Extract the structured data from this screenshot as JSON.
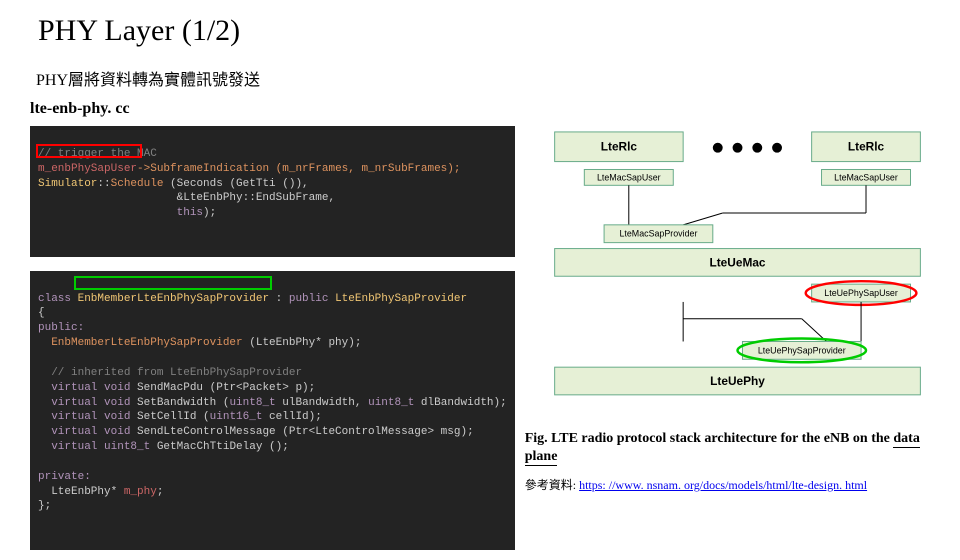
{
  "title": "PHY Layer (1/2)",
  "subtitle": "PHY層將資料轉為實體訊號發送",
  "filename": "lte-enb-phy. cc",
  "code1": {
    "c0": "// trigger the MAC",
    "l1a": "m_enbPhySapUser",
    "l1b": "->SubframeIndication (m_nrFrames, m_nrSubFrames);",
    "l2a": "Simulator",
    "l2b": "::",
    "l2c": "Schedule",
    "l2d": " (Seconds (GetTti ()),",
    "l3": "                     &LteEnbPhy::EndSubFrame,",
    "l4a": "                     ",
    "l4b": "this",
    "l4c": ");"
  },
  "code2": {
    "l1a": "class ",
    "l1b": "EnbMemberLteEnbPhySapProvider",
    "l1c": " : ",
    "l1d": "public",
    "l1e": " LteEnbPhySapProvider",
    "l2": "{",
    "l3": "public:",
    "l4a": "  ",
    "l4b": "EnbMemberLteEnbPhySapProvider",
    "l4c": " (LteEnbPhy* phy);",
    "blank": "",
    "c2": "  // inherited from LteEnbPhySapProvider",
    "l5a": "  virtual ",
    "l5b": "void",
    "l5c": " SendMacPdu (Ptr<Packet> p);",
    "l6a": "  virtual ",
    "l6b": "void",
    "l6c": " SetBandwidth (",
    "l6d": "uint8_t",
    "l6e": " ulBandwidth, ",
    "l6f": "uint8_t",
    "l6g": " dlBandwidth);",
    "l7a": "  virtual ",
    "l7b": "void",
    "l7c": " SetCellId (",
    "l7d": "uint16_t",
    "l7e": " cellId);",
    "l8a": "  virtual ",
    "l8b": "void",
    "l8c": " SendLteControlMessage (Ptr<LteControlMessage> msg);",
    "l9a": "  virtual ",
    "l9b": "uint8_t",
    "l9c": " GetMacChTtiDelay ();",
    "l10": "",
    "l11": "private:",
    "l12a": "  LteEnbPhy* ",
    "l12b": "m_phy",
    "l12c": ";",
    "l13": "};"
  },
  "diagram": {
    "rlc_l": "LteRlc",
    "rlc_r": "LteRlc",
    "macsapu_l": "LteMacSapUser",
    "macsapu_r": "LteMacSapUser",
    "macsapp": "LteMacSapProvider",
    "uemac": "LteUeMac",
    "physapu": "LteUePhySapUser",
    "physapp": "LteUePhySapProvider",
    "uephy": "LteUePhy"
  },
  "caption_a": "Fig. LTE radio protocol stack architecture for the eNB on the ",
  "caption_b": "data plane",
  "ref_prefix": "參考資料: ",
  "ref_link": "https: //www. nsnam. org/docs/models/html/lte-design. html"
}
